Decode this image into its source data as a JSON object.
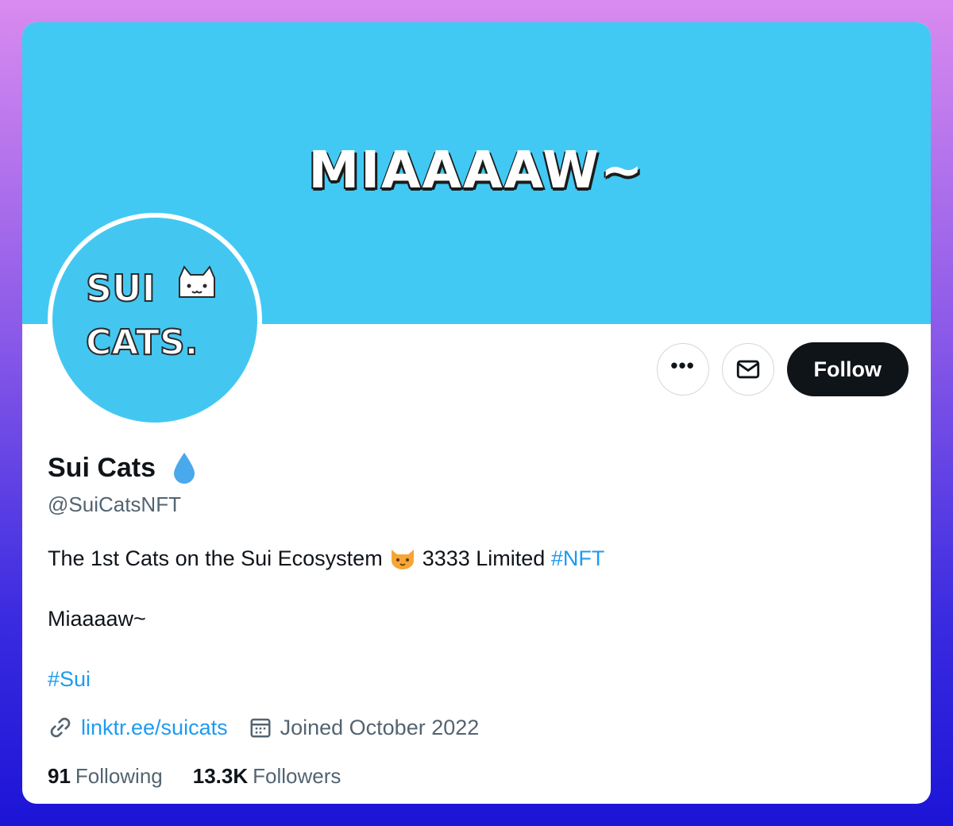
{
  "profile": {
    "banner_text": "MIAAAAW~",
    "avatar_text_line1": "SUI",
    "avatar_text_line2": "CATS.",
    "name": "Sui Cats",
    "handle": "@SuiCatsNFT",
    "bio": {
      "line1_text": "The 1st Cats on the Sui Ecosystem",
      "line1_suffix": "3333 Limited",
      "line1_hashtag": "#NFT",
      "line2": "Miaaaaw~",
      "line3_hashtag": "#Sui"
    },
    "website": "linktr.ee/suicats",
    "joined": "Joined October 2022",
    "following_count": "91",
    "following_label": "Following",
    "followers_count": "13.3K",
    "followers_label": "Followers"
  },
  "actions": {
    "more_label": "•••",
    "follow_label": "Follow"
  },
  "icons": {
    "verified_drop": "drop-icon",
    "message": "envelope-icon",
    "link": "link-icon",
    "calendar": "calendar-icon",
    "cat_emoji": "cat-face-emoji"
  },
  "colors": {
    "banner": "#41c9f4",
    "accent": "#1d9bf0",
    "follow_button": "#0f1419",
    "secondary_text": "#536471"
  }
}
